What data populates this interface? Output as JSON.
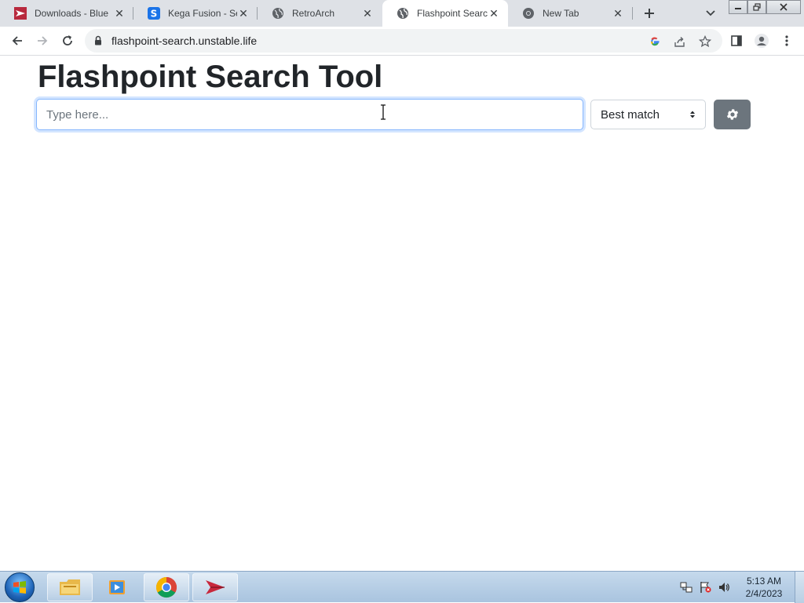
{
  "browser": {
    "tabs": [
      {
        "title": "Downloads - Blue",
        "favicon": "blue-arrow-icon"
      },
      {
        "title": "Kega Fusion - Seg",
        "favicon": "s-logo-icon"
      },
      {
        "title": "RetroArch",
        "favicon": "globe-icon"
      },
      {
        "title": "Flashpoint Search",
        "favicon": "globe-icon",
        "active": true
      },
      {
        "title": "New Tab",
        "favicon": "chrome-icon"
      }
    ],
    "url": "flashpoint-search.unstable.life"
  },
  "page": {
    "title": "Flashpoint Search Tool",
    "search_placeholder": "Type here...",
    "sort_value": "Best match",
    "settings_icon": "gear-icon"
  },
  "taskbar": {
    "time": "5:13 AM",
    "date": "2/4/2023"
  },
  "colors": {
    "tab_strip": "#dee1e6",
    "settings_button": "#6c757d",
    "input_focus_border": "#86b7fe",
    "taskbar": "#b8cfe6"
  }
}
